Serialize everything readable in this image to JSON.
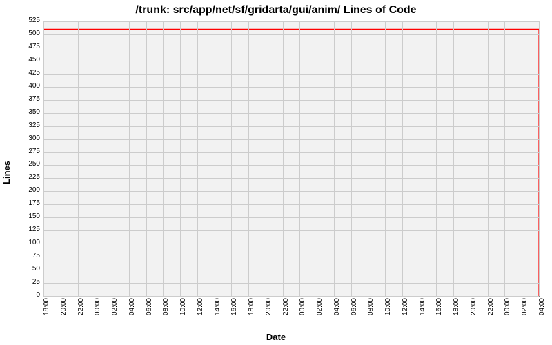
{
  "chart_data": {
    "type": "line",
    "title": "/trunk: src/app/net/sf/gridarta/gui/anim/ Lines of Code",
    "xlabel": "Date",
    "ylabel": "Lines",
    "ylim": [
      0,
      525
    ],
    "yticks": [
      0,
      25,
      50,
      75,
      100,
      125,
      150,
      175,
      200,
      225,
      250,
      275,
      300,
      325,
      350,
      375,
      400,
      425,
      450,
      475,
      500,
      525
    ],
    "xticks": [
      "18:00",
      "20:00",
      "22:00",
      "00:00",
      "02:00",
      "04:00",
      "06:00",
      "08:00",
      "10:00",
      "12:00",
      "14:00",
      "16:00",
      "18:00",
      "20:00",
      "22:00",
      "00:00",
      "02:00",
      "04:00",
      "06:00",
      "08:00",
      "10:00",
      "12:00",
      "14:00",
      "16:00",
      "18:00",
      "20:00",
      "22:00",
      "00:00",
      "02:00",
      "04:00"
    ],
    "series": [
      {
        "name": "lines-of-code",
        "color": "#ff0000",
        "x_index": [
          0,
          0,
          29,
          29
        ],
        "y": [
          0,
          510,
          510,
          0
        ]
      }
    ]
  }
}
